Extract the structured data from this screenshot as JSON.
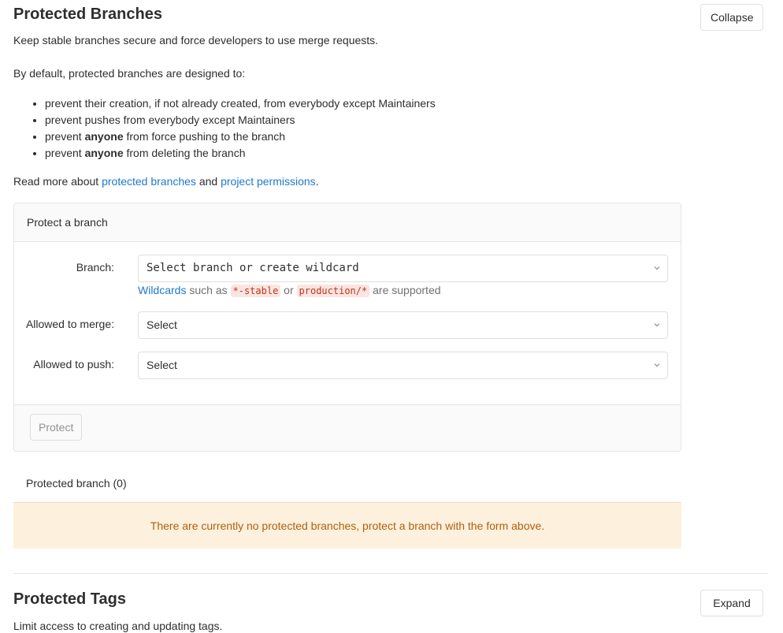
{
  "branches": {
    "title": "Protected Branches",
    "collapse_label": "Collapse",
    "description": "Keep stable branches secure and force developers to use merge requests.",
    "intro": "By default, protected branches are designed to:",
    "rules": [
      {
        "pre": "prevent their creation, if not already created, from everybody except Maintainers",
        "bold": "",
        "post": ""
      },
      {
        "pre": "prevent pushes from everybody except Maintainers",
        "bold": "",
        "post": ""
      },
      {
        "pre": "prevent ",
        "bold": "anyone",
        "post": " from force pushing to the branch"
      },
      {
        "pre": "prevent ",
        "bold": "anyone",
        "post": " from deleting the branch"
      }
    ],
    "read_more": {
      "prefix": "Read more about ",
      "link1": "protected branches",
      "middle": " and ",
      "link2": "project permissions",
      "suffix": "."
    }
  },
  "form": {
    "header": "Protect a branch",
    "branch_label": "Branch:",
    "branch_placeholder": "Select branch or create wildcard",
    "hint": {
      "link": "Wildcards",
      "text1": " such as ",
      "code1": "*-stable",
      "text2": " or ",
      "code2": "production/*",
      "text3": " are supported"
    },
    "merge_label": "Allowed to merge:",
    "merge_value": "Select",
    "push_label": "Allowed to push:",
    "push_value": "Select",
    "protect_label": "Protect"
  },
  "list": {
    "count_label": "Protected branch (0)",
    "empty_message": "There are currently no protected branches, protect a branch with the form above."
  },
  "tags": {
    "title": "Protected Tags",
    "expand_label": "Expand",
    "description": "Limit access to creating and updating tags."
  },
  "colors": {
    "link": "#1f78d1",
    "warning_text": "#b35d0e",
    "warning_bg": "#fdf1dd",
    "code_text": "#c0341d"
  }
}
